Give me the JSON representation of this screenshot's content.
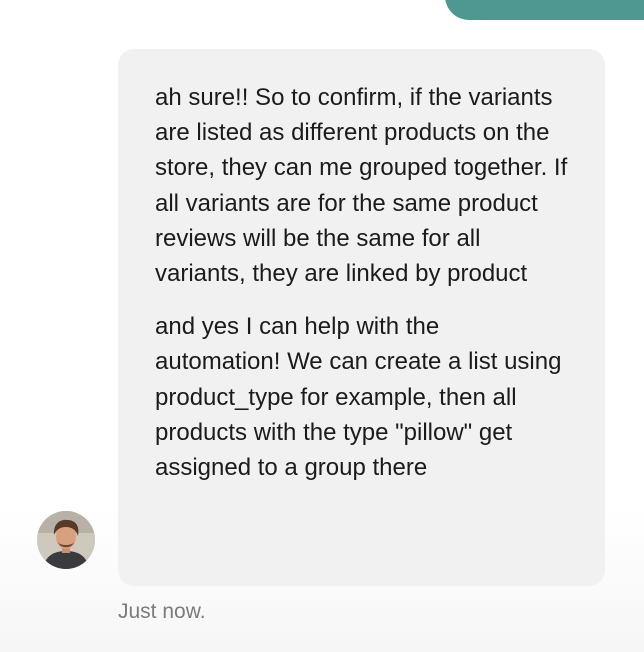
{
  "previous_message": {
    "color": "#4f9892"
  },
  "message": {
    "sender_avatar": "user-avatar",
    "paragraphs": [
      "ah sure!! So to confirm, if the variants are listed as different products on the store, they can me grouped together. If all variants are for the same product reviews will be the same for all variants, they are linked by product",
      "and yes I can help with the automation! We can create a list using product_type for example, then all products with the type \"pillow\" get assigned to a group there"
    ],
    "timestamp": "Just now."
  },
  "colors": {
    "bubble_bg": "#f1f1f1",
    "text": "#1b1b1b",
    "timestamp": "#7b7b7b",
    "accent": "#4f9892"
  }
}
